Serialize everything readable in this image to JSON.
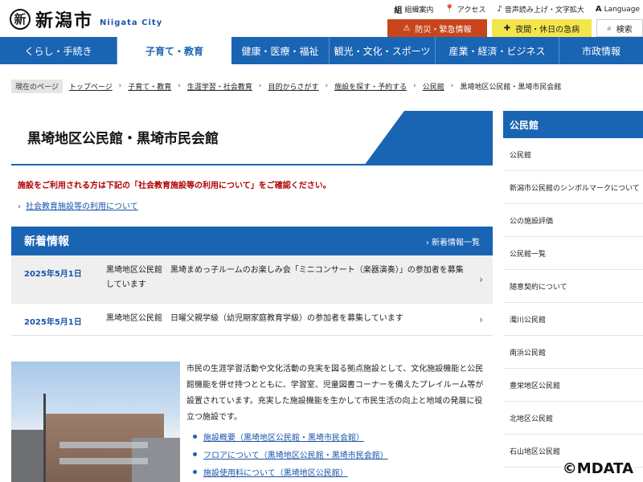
{
  "header": {
    "logo_mark": "新",
    "logo_text": "新潟市",
    "logo_en": "Niigata City",
    "util": [
      {
        "icon": "組",
        "label": "組織案内"
      },
      {
        "icon": "📍",
        "label": "アクセス"
      },
      {
        "icon": "♪",
        "label": "音声読み上げ・文字拡大"
      },
      {
        "icon": "A",
        "label": "Language"
      }
    ],
    "alert_disaster": "防災・緊急情報",
    "alert_night": "夜間・休日の急病",
    "search": "検索"
  },
  "nav": [
    "くらし・手続き",
    "子育て・教育",
    "健康・医療・福祉",
    "観光・文化・スポーツ",
    "産業・経済・ビジネス",
    "市政情報"
  ],
  "breadcrumb": {
    "here": "現在のページ",
    "items": [
      "トップページ",
      "子育て・教育",
      "生涯学習・社会教育",
      "目的からさがす",
      "施設を探す・予約する",
      "公民館",
      "黒埼地区公民館・黒埼市民会館"
    ]
  },
  "page": {
    "title": "黒埼地区公民館・黒埼市民会館",
    "notice": "施設をご利用される方は下記の「社会教育施設等の利用について」をご確認ください。",
    "notice_link": "社会教育施設等の利用について"
  },
  "news": {
    "heading": "新着情報",
    "more": "新着情報一覧",
    "items": [
      {
        "date": "2025年5月1日",
        "text": "黒埼地区公民館　黒埼まめっ子ルームのお楽しみ会「ミニコンサート（楽器演奏）」の参加者を募集しています"
      },
      {
        "date": "2025年5月1日",
        "text": "黒埼地区公民館　日曜父親学級（幼児期家庭教育学級）の参加者を募集しています"
      }
    ]
  },
  "description": "市民の生涯学習活動や文化活動の充実を図る拠点施設として、文化施設機能と公民館機能を併せ持つとともに、学習室、児童図書コーナーを備えたプレイルーム等が設置されています。充実した施設機能を生かして市民生活の向上と地域の発展に役立つ施設です。",
  "links": [
    "施設概要（黒埼地区公民館・黒埼市民会館）",
    "フロアについて（黒埼地区公民館・黒埼市民会館）",
    "施設使用料について（黒埼地区公民館）"
  ],
  "sidebar": {
    "heading": "公民館",
    "items": [
      "公民館",
      "新潟市公民館のシンボルマークについて",
      "公の施設評価",
      "公民館一覧",
      "随意契約について",
      "濁川公民館",
      "南浜公民館",
      "豊栄地区公民館",
      "北地区公民館",
      "石山地区公民館"
    ]
  },
  "watermark": "©MDATA",
  "colors": {
    "primary": "#1a64b4",
    "alert": "#c8451c",
    "night": "#f3e54a",
    "notice": "#b00000"
  }
}
